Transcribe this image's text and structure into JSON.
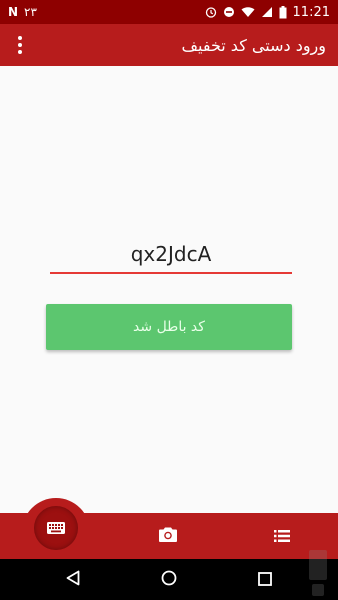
{
  "status_bar": {
    "notification_letter": "N",
    "notification_count": "۲۳",
    "time": "11:21"
  },
  "app_bar": {
    "title": "ورود دستی کد تخفیف"
  },
  "form": {
    "code_value": "qx2JdcA",
    "submit_label": "کد باطل شد"
  },
  "bottom_nav": {
    "items": [
      "keyboard-icon",
      "camera-icon",
      "list-icon"
    ]
  },
  "system_nav": {
    "items": [
      "back-icon",
      "home-icon",
      "recents-icon"
    ]
  },
  "colors": {
    "primary": "#b71c1c",
    "status_bar": "#8e0000",
    "accent_underline": "#e53935",
    "button_green": "#5cc66f"
  }
}
